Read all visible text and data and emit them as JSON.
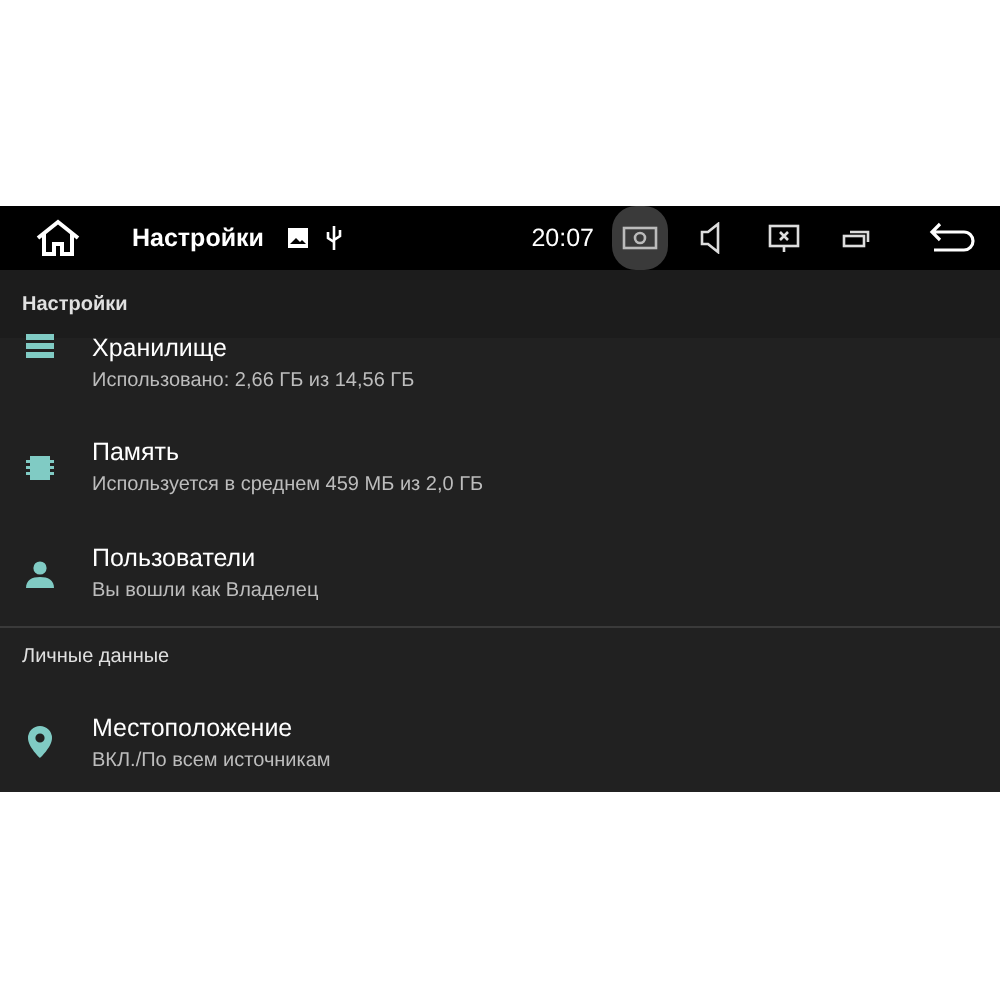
{
  "status_bar": {
    "title": "Настройки",
    "time": "20:07",
    "buttons": [
      {
        "kind": "screenshot",
        "selected": true
      },
      {
        "kind": "volume",
        "selected": false
      },
      {
        "kind": "screen-off",
        "selected": false
      },
      {
        "kind": "recents",
        "selected": false
      }
    ]
  },
  "header": "Настройки",
  "sections": [
    {
      "rows": [
        {
          "kind": "storage",
          "title": "Хранилище",
          "summary": "Использовано: 2,66 ГБ из 14,56 ГБ"
        },
        {
          "kind": "memory",
          "title": "Память",
          "summary": "Используется в среднем 459 МБ из 2,0 ГБ"
        },
        {
          "kind": "user",
          "title": "Пользователи",
          "summary": "Вы вошли как Владелец"
        }
      ]
    },
    {
      "title": "Личные данные",
      "rows": [
        {
          "kind": "location",
          "title": "Местоположение",
          "summary": "ВКЛ./По всем источникам"
        }
      ]
    }
  ]
}
